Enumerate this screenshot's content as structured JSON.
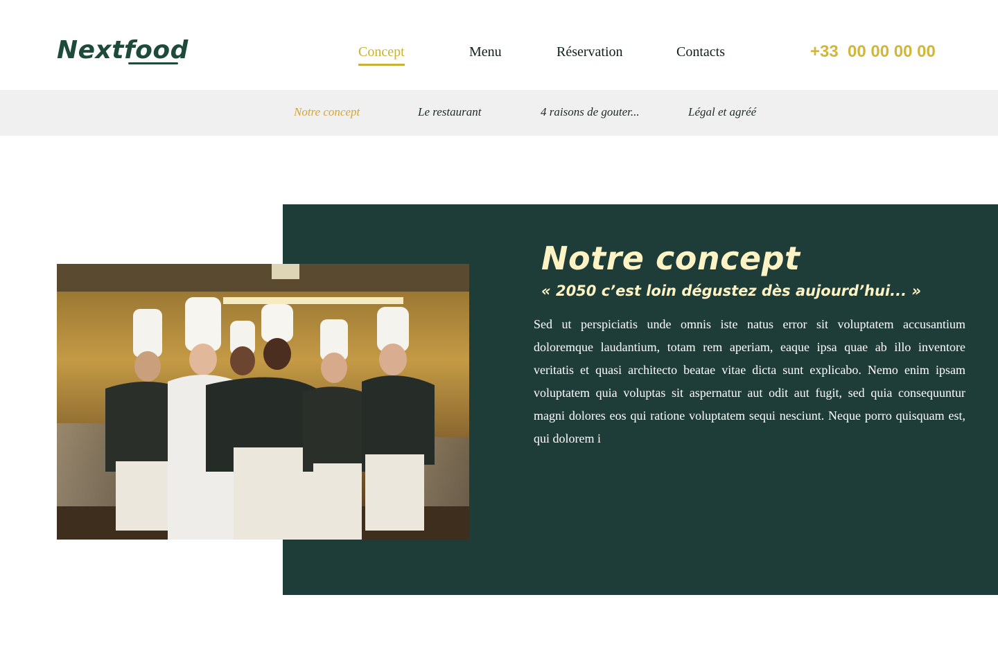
{
  "header": {
    "logo_text": "Nextfood",
    "nav": [
      {
        "label": "Concept",
        "active": true
      },
      {
        "label": "Menu",
        "active": false
      },
      {
        "label": "Réservation",
        "active": false
      },
      {
        "label": "Contacts",
        "active": false
      }
    ],
    "phone": "+33  00 00 00 00"
  },
  "subnav": {
    "items": [
      {
        "label": "Notre concept",
        "active": true
      },
      {
        "label": "Le restaurant",
        "active": false
      },
      {
        "label": "4 raisons de gouter...",
        "active": false
      },
      {
        "label": "Légal et agréé",
        "active": false
      }
    ]
  },
  "concept": {
    "title": "Notre concept",
    "subtitle": "« 2050 c’est loin dégustez dès aujourd’hui... »",
    "body": "Sed ut perspiciatis unde omnis iste natus error sit voluptatem accusantium doloremque laudantium, totam rem aperiam, eaque ipsa quae ab illo inventore veritatis et quasi architecto beatae vitae dicta sunt explicabo. Nemo enim ipsam voluptatem quia voluptas sit aspernatur aut odit aut fugit, sed quia consequuntur magni dolores eos qui ratione voluptatem sequi nesciunt. Neque porro quisquam est, qui dolorem i"
  },
  "colors": {
    "brand_green": "#1e4a3c",
    "panel_green": "#1e3c38",
    "accent_gold": "#c9b135",
    "title_cream": "#fdf3c4",
    "subnav_bg": "#f0f0f0"
  }
}
